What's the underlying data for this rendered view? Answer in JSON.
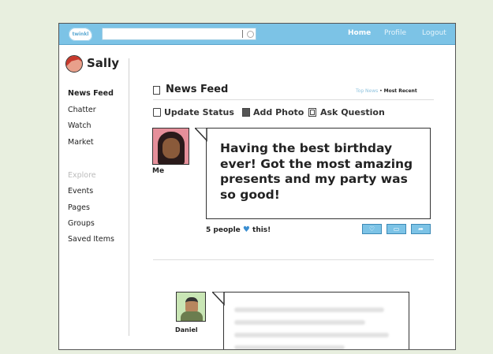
{
  "topbar": {
    "logo": "twinkl",
    "nav": {
      "home": "Home",
      "profile": "Profile",
      "logout": "Logout"
    }
  },
  "profile": {
    "name": "Sally"
  },
  "sidebar": {
    "items": [
      "News Feed",
      "Chatter",
      "Watch",
      "Market"
    ],
    "explore_heading": "Explore",
    "explore_items": [
      "Events",
      "Pages",
      "Groups",
      "Saved Items"
    ]
  },
  "feed": {
    "title": "News Feed",
    "toggle_top": "Top News",
    "toggle_separator": " • ",
    "toggle_recent": "Most Recent",
    "actions": {
      "update_status": "Update Status",
      "add_photo": "Add Photo",
      "ask_question": "Ask Question"
    }
  },
  "post": {
    "author": "Me",
    "text": "Having the best birthday ever! Got the most amazing presents and my party was so good!",
    "likes_prefix": "5 people",
    "likes_suffix": "this!"
  },
  "post2": {
    "author": "Daniel"
  },
  "colors": {
    "accent": "#7cc3e6",
    "heart": "#3b8ed1",
    "background": "#e8efdf"
  },
  "icons": [
    "search-icon",
    "news-feed-icon",
    "update-status-icon",
    "add-photo-icon",
    "ask-question-icon",
    "like-icon",
    "comment-icon",
    "share-icon",
    "heart-icon"
  ]
}
